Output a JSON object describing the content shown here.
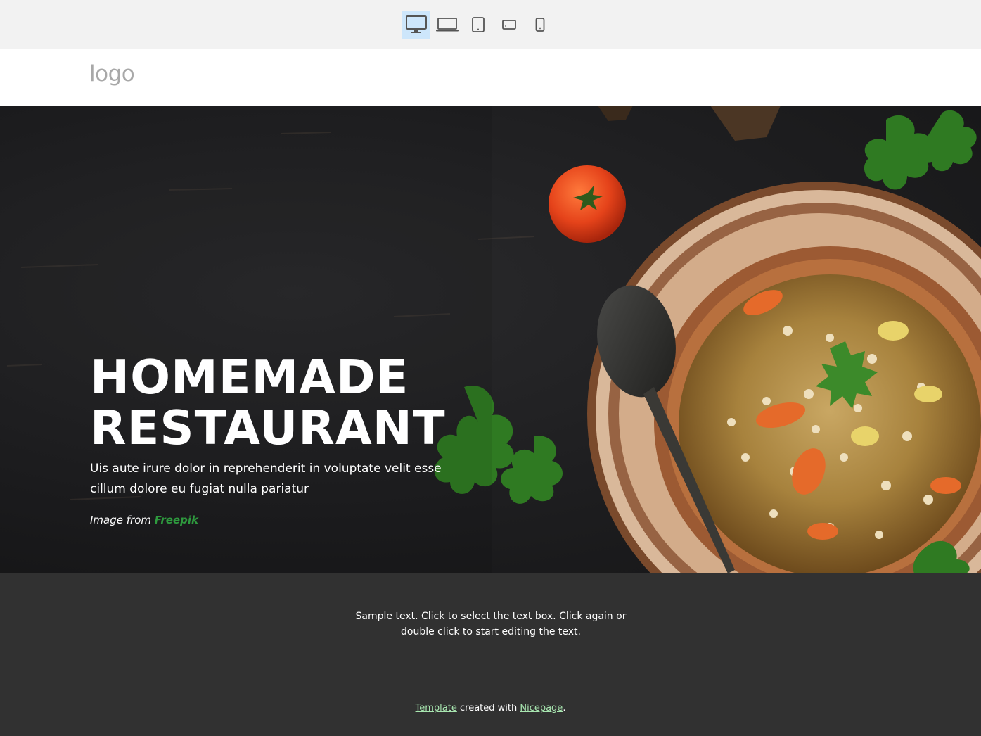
{
  "toolbar": {
    "devices": [
      {
        "icon": "desktop-icon",
        "active": true
      },
      {
        "icon": "laptop-icon",
        "active": false
      },
      {
        "icon": "tablet-icon",
        "active": false
      },
      {
        "icon": "tablet-landscape-icon",
        "active": false
      },
      {
        "icon": "phone-icon",
        "active": false
      }
    ],
    "active_color": "#cde6fb"
  },
  "header": {
    "logo_text": "logo"
  },
  "hero": {
    "title_line1": "HOMEMADE",
    "title_line2": "RESTAURANT",
    "subtitle": "Uis aute irure dolor in reprehenderit in voluptate velit esse cillum dolore eu fugiat nulla pariatur",
    "credit_prefix": "Image from ",
    "credit_link": "Freepik",
    "credit_link_color": "#2e9a3e"
  },
  "section": {
    "sample_text": "Sample text. Click to select the text box. Click again or double click to start editing the text.",
    "background": "#313131"
  },
  "footer": {
    "template_link": "Template",
    "middle_text": " created with ",
    "nicepage_link": "Nicepage",
    "end_text": "."
  }
}
